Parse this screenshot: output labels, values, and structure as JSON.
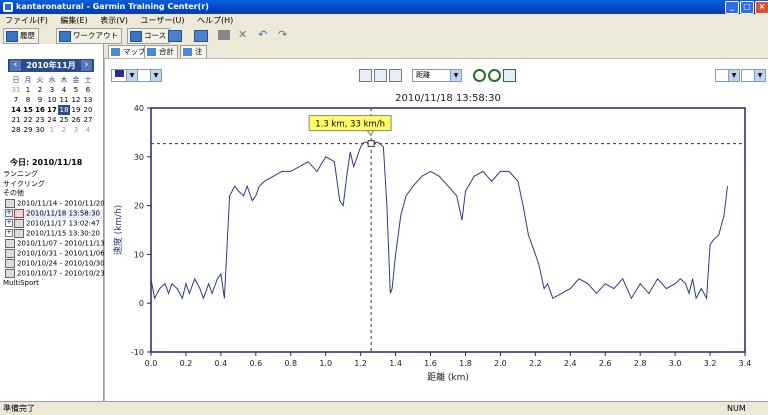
{
  "window": {
    "title": "kantaronatural - Garmin Training Center(r)"
  },
  "menu": [
    "ファイル(F)",
    "編集(E)",
    "表示(V)",
    "ユーザー(U)",
    "ヘルプ(H)"
  ],
  "toolbar": {
    "history_label": "履歴",
    "workout_label": "ワークアウト",
    "course_label": "コース"
  },
  "calendar": {
    "month_label": "2010年11月",
    "dow": [
      "日",
      "月",
      "火",
      "水",
      "木",
      "金",
      "土"
    ],
    "days": [
      "31",
      "1",
      "2",
      "3",
      "4",
      "5",
      "6",
      "7",
      "8",
      "9",
      "10",
      "11",
      "12",
      "13",
      "14",
      "15",
      "16",
      "17",
      "18",
      "19",
      "20",
      "21",
      "22",
      "23",
      "24",
      "25",
      "26",
      "27",
      "28",
      "29",
      "30",
      "1",
      "2",
      "3",
      "4"
    ],
    "today_label": "今日: 2010/11/18",
    "selected": "18"
  },
  "tree": {
    "categories": [
      "ランニング",
      "サイクリング",
      "その他"
    ],
    "entries": [
      "2010/11/14 - 2010/11/20",
      "2010/11/18 13:58:30",
      "2010/11/17 13:02:47",
      "2010/11/15 13:30:20",
      "2010/11/07 - 2010/11/13",
      "2010/10/31 - 2010/11/06",
      "2010/10/24 - 2010/10/30",
      "2010/10/17 - 2010/10/23"
    ],
    "multisport": "MultiSport"
  },
  "tabs": [
    "マップ",
    "合計",
    "注"
  ],
  "chart_tools": {
    "xaxis_select": "距離"
  },
  "status": {
    "left": "準備完了",
    "right": "NUM"
  },
  "colors": {
    "line": "#2b3b8f",
    "axis": "#23227a",
    "tooltip": "#ffff66",
    "titlebar": "#0a5fd8"
  },
  "chart_data": {
    "type": "line",
    "title": "2010/11/18 13:58:30",
    "xlabel": "距離 (km)",
    "ylabel": "速度 (km/h)",
    "xlim": [
      0,
      3.4
    ],
    "ylim": [
      -10,
      40
    ],
    "xticks": [
      "0.0",
      "0.2",
      "0.4",
      "0.6",
      "0.8",
      "1.0",
      "1.2",
      "1.4",
      "1.6",
      "1.8",
      "2.0",
      "2.2",
      "2.4",
      "2.6",
      "2.8",
      "3.0",
      "3.2",
      "3.4"
    ],
    "yticks": [
      "40",
      "30",
      "20",
      "10",
      "0",
      "-10"
    ],
    "tooltip": "1.3 km, 33 km/h",
    "marker": {
      "x": 1.26,
      "y": 32.7
    },
    "grid": true,
    "x": [
      0.0,
      0.02,
      0.05,
      0.08,
      0.1,
      0.12,
      0.15,
      0.18,
      0.2,
      0.22,
      0.25,
      0.28,
      0.3,
      0.33,
      0.35,
      0.38,
      0.4,
      0.42,
      0.45,
      0.48,
      0.5,
      0.53,
      0.55,
      0.58,
      0.6,
      0.62,
      0.65,
      0.7,
      0.75,
      0.8,
      0.85,
      0.9,
      0.95,
      1.0,
      1.05,
      1.08,
      1.1,
      1.12,
      1.14,
      1.16,
      1.18,
      1.2,
      1.22,
      1.24,
      1.26,
      1.3,
      1.33,
      1.35,
      1.37,
      1.38,
      1.4,
      1.43,
      1.46,
      1.5,
      1.55,
      1.6,
      1.65,
      1.7,
      1.75,
      1.78,
      1.8,
      1.85,
      1.9,
      1.95,
      2.0,
      2.05,
      2.1,
      2.13,
      2.16,
      2.18,
      2.2,
      2.22,
      2.25,
      2.27,
      2.3,
      2.35,
      2.4,
      2.45,
      2.5,
      2.55,
      2.6,
      2.65,
      2.7,
      2.75,
      2.8,
      2.85,
      2.9,
      2.95,
      3.0,
      3.03,
      3.06,
      3.08,
      3.1,
      3.12,
      3.15,
      3.18,
      3.2,
      3.22,
      3.25,
      3.28,
      3.3
    ],
    "y": [
      5,
      1,
      3,
      4,
      2,
      4,
      3,
      1,
      4,
      2,
      5,
      3,
      1,
      4,
      2,
      5,
      6,
      1,
      22,
      24,
      23,
      22,
      24,
      21,
      22,
      24,
      25,
      26,
      27,
      27,
      28,
      29,
      27,
      30,
      29,
      21,
      20,
      26,
      31,
      28,
      30,
      32,
      33,
      33,
      33,
      33,
      32,
      20,
      2,
      3,
      10,
      18,
      22,
      24,
      26,
      27,
      26,
      24,
      22,
      17,
      23,
      26,
      27,
      25,
      27,
      27,
      25,
      20,
      14,
      12,
      10,
      8,
      3,
      4,
      1,
      2,
      3,
      5,
      4,
      2,
      4,
      3,
      5,
      1,
      4,
      2,
      5,
      3,
      4,
      5,
      4,
      2,
      5,
      1,
      3,
      1,
      12,
      13,
      14,
      18,
      24,
      25,
      25
    ]
  }
}
